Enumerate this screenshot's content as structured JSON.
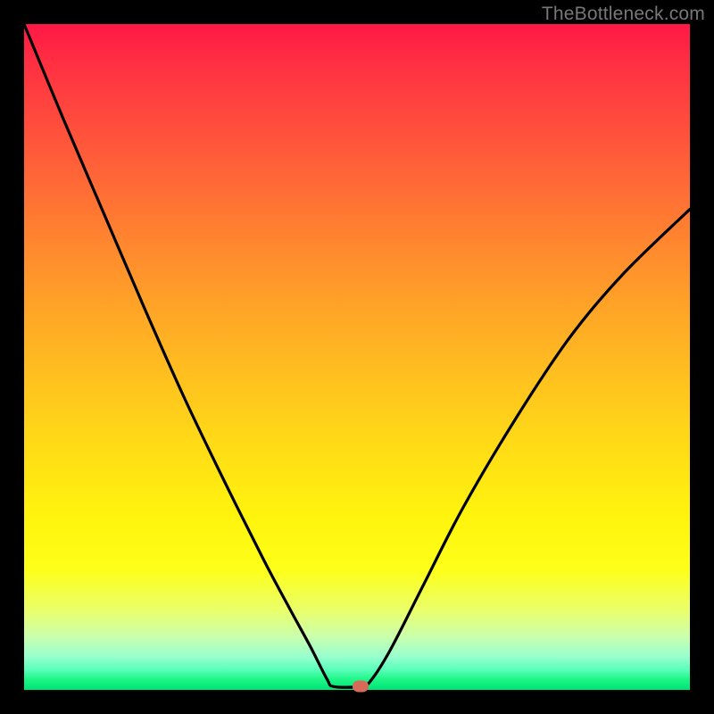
{
  "watermark": "TheBottleneck.com",
  "colors": {
    "frame": "#000000",
    "curve": "#000000",
    "marker": "#d86a5a",
    "watermark": "#777777",
    "gradient_stops": [
      {
        "pos": 0,
        "hex": "#ff1846"
      },
      {
        "pos": 0.06,
        "hex": "#ff3042"
      },
      {
        "pos": 0.14,
        "hex": "#ff4a3d"
      },
      {
        "pos": 0.24,
        "hex": "#ff6a36"
      },
      {
        "pos": 0.34,
        "hex": "#ff8a2e"
      },
      {
        "pos": 0.44,
        "hex": "#ffa826"
      },
      {
        "pos": 0.54,
        "hex": "#ffc31e"
      },
      {
        "pos": 0.64,
        "hex": "#ffdd16"
      },
      {
        "pos": 0.74,
        "hex": "#fff40d"
      },
      {
        "pos": 0.82,
        "hex": "#fdff1a"
      },
      {
        "pos": 0.88,
        "hex": "#eaff6a"
      },
      {
        "pos": 0.92,
        "hex": "#caffad"
      },
      {
        "pos": 0.95,
        "hex": "#98ffcf"
      },
      {
        "pos": 0.97,
        "hex": "#58ffb8"
      },
      {
        "pos": 0.985,
        "hex": "#1cf585"
      },
      {
        "pos": 1.0,
        "hex": "#00e377"
      }
    ]
  },
  "chart_data": {
    "type": "line",
    "title": "",
    "xlabel": "",
    "ylabel": "",
    "xlim": [
      0,
      1
    ],
    "ylim": [
      0,
      1
    ],
    "series": [
      {
        "name": "curve",
        "x": [
          0.0,
          0.06,
          0.12,
          0.18,
          0.24,
          0.3,
          0.36,
          0.4,
          0.43,
          0.455,
          0.465,
          0.505,
          0.52,
          0.55,
          0.6,
          0.66,
          0.74,
          0.82,
          0.9,
          1.0
        ],
        "y": [
          1.0,
          0.855,
          0.715,
          0.575,
          0.44,
          0.315,
          0.195,
          0.12,
          0.065,
          0.016,
          0.005,
          0.005,
          0.013,
          0.06,
          0.158,
          0.275,
          0.41,
          0.53,
          0.625,
          0.722
        ]
      }
    ],
    "marker": {
      "x": 0.505,
      "y": 0.005
    },
    "notes": "V-shaped curve on a vertical red→green gradient background; minimum (marker) around x≈0.505 at the bottom edge. Axes are unlabeled; values are normalized fractions of the plot area."
  }
}
